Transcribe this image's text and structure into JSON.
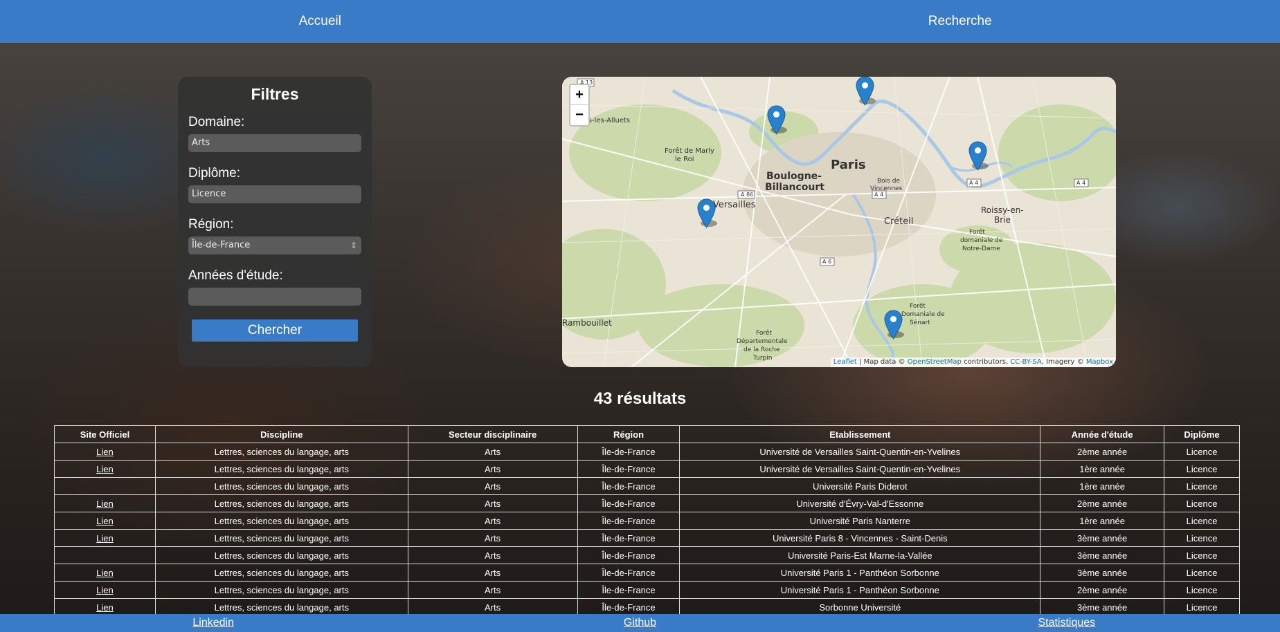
{
  "nav": {
    "home": "Accueil",
    "search": "Recherche"
  },
  "filters": {
    "title": "Filtres",
    "domain_label": "Domaine:",
    "domain_value": "Arts",
    "diploma_label": "Diplôme:",
    "diploma_value": "Licence",
    "region_label": "Région:",
    "region_value": "Île-de-France",
    "years_label": "Années d'étude:",
    "years_value": "",
    "search_button": "Chercher"
  },
  "map": {
    "zoom_in": "+",
    "zoom_out": "−",
    "labels": {
      "paris": "Paris",
      "boulogne_1": "Boulogne-",
      "boulogne_2": "Billancourt",
      "versailles": "Versailles",
      "creteil": "Créteil",
      "roissy_1": "Roissy-en-",
      "roissy_2": "Brie",
      "rambouillet": "Rambouillet",
      "marly_1": "Forêt de Marly",
      "marly_2": "le Roi",
      "alluets": "is-les-Alluets",
      "vincennes_1": "Bois de",
      "vincennes_2": "Vincennes",
      "notredame_1": "Forêt",
      "notredame_2": "domaniale de",
      "notredame_3": "Notre-Dame",
      "senart_1": "Forêt",
      "senart_2": "Domaniale de",
      "senart_3": "Sénart",
      "roche_1": "Forêt",
      "roche_2": "Départementale",
      "roche_3": "de la Roche",
      "roche_4": "Turpin",
      "a13": "A 13",
      "a86": "A 86",
      "a4_1": "A 4",
      "a4_2": "A 4",
      "a4_3": "A 4",
      "a6": "A 6"
    },
    "attribution": {
      "leaflet": "Leaflet",
      "text1": " | Map data © ",
      "osm": "OpenStreetMap",
      "text2": " contributors, ",
      "ccbysa": "CC-BY-SA",
      "text3": ", Imagery © ",
      "mapbox": "Mapbox"
    },
    "marker_color": "#2a81cb"
  },
  "results": {
    "count_text": "43 résultats",
    "headers": [
      "Site Officiel",
      "Discipline",
      "Secteur disciplinaire",
      "Région",
      "Etablissement",
      "Année d'étude",
      "Diplôme"
    ],
    "rows": [
      [
        "Lien",
        "Lettres, sciences du langage, arts",
        "Arts",
        "Île-de-France",
        "Université de Versailles Saint-Quentin-en-Yvelines",
        "2ème année",
        "Licence"
      ],
      [
        "Lien",
        "Lettres, sciences du langage, arts",
        "Arts",
        "Île-de-France",
        "Université de Versailles Saint-Quentin-en-Yvelines",
        "1ère année",
        "Licence"
      ],
      [
        "",
        "Lettres, sciences du langage, arts",
        "Arts",
        "Île-de-France",
        "Université Paris Diderot",
        "1ère année",
        "Licence"
      ],
      [
        "Lien",
        "Lettres, sciences du langage, arts",
        "Arts",
        "Île-de-France",
        "Université d'Évry-Val-d'Essonne",
        "2ème année",
        "Licence"
      ],
      [
        "Lien",
        "Lettres, sciences du langage, arts",
        "Arts",
        "Île-de-France",
        "Université Paris Nanterre",
        "1ère année",
        "Licence"
      ],
      [
        "Lien",
        "Lettres, sciences du langage, arts",
        "Arts",
        "Île-de-France",
        "Université Paris 8 - Vincennes - Saint-Denis",
        "3ème année",
        "Licence"
      ],
      [
        "",
        "Lettres, sciences du langage, arts",
        "Arts",
        "Île-de-France",
        "Université Paris-Est Marne-la-Vallée",
        "3ème année",
        "Licence"
      ],
      [
        "Lien",
        "Lettres, sciences du langage, arts",
        "Arts",
        "Île-de-France",
        "Université Paris 1 - Panthéon Sorbonne",
        "3ème année",
        "Licence"
      ],
      [
        "Lien",
        "Lettres, sciences du langage, arts",
        "Arts",
        "Île-de-France",
        "Université Paris 1 - Panthéon Sorbonne",
        "2ème année",
        "Licence"
      ],
      [
        "Lien",
        "Lettres, sciences du langage, arts",
        "Arts",
        "Île-de-France",
        "Sorbonne Université",
        "3ème année",
        "Licence"
      ]
    ]
  },
  "footer": {
    "linkedin": "Linkedin",
    "github": "Github",
    "stats": "Statistiques"
  }
}
